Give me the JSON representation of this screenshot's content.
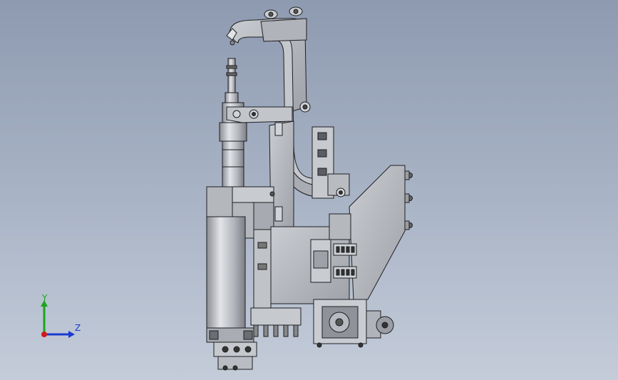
{
  "viewport": {
    "background_top": "#8e9ab0",
    "background_bottom": "#c4ccd9"
  },
  "model": {
    "description_icon": "mechanical-assembly-icon",
    "part_fill": "#b9bcc2",
    "part_fill_light": "#d3d6db",
    "part_fill_dark": "#8d9097",
    "edge_color": "#1e1f22"
  },
  "triad": {
    "y_label": "Y",
    "z_label": "Z",
    "y_color": "#1aa61a",
    "z_color": "#1a3ccf",
    "x_color": "#d21a1a"
  }
}
